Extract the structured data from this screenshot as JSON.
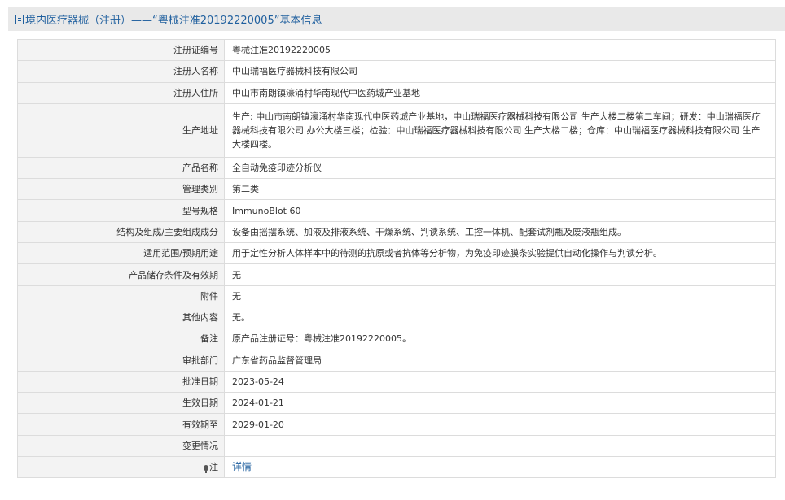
{
  "header": {
    "title": "境内医疗器械（注册）——“粤械注准20192220005”基本信息"
  },
  "rows": [
    {
      "label": "注册证编号",
      "value": "粤械注准20192220005"
    },
    {
      "label": "注册人名称",
      "value": "中山瑞福医疗器械科技有限公司"
    },
    {
      "label": "注册人住所",
      "value": "中山市南朗镇濠涌村华南现代中医药城产业基地"
    },
    {
      "label": "生产地址",
      "value": "生产: 中山市南朗镇濠涌村华南现代中医药城产业基地，中山瑞福医疗器械科技有限公司 生产大楼二楼第二车间；研发：中山瑞福医疗器械科技有限公司 办公大楼三楼；检验：中山瑞福医疗器械科技有限公司 生产大楼二楼；仓库：中山瑞福医疗器械科技有限公司 生产大楼四楼。"
    },
    {
      "label": "产品名称",
      "value": "全自动免疫印迹分析仪"
    },
    {
      "label": "管理类别",
      "value": "第二类"
    },
    {
      "label": "型号规格",
      "value": "ImmunoBlot 60"
    },
    {
      "label": "结构及组成/主要组成成分",
      "value": "设备由摇摆系统、加液及排液系统、干燥系统、判读系统、工控一体机、配套试剂瓶及废液瓶组成。"
    },
    {
      "label": "适用范围/预期用途",
      "value": "用于定性分析人体样本中的待测的抗原或者抗体等分析物，为免疫印迹膜条实验提供自动化操作与判读分析。"
    },
    {
      "label": "产品储存条件及有效期",
      "value": "无"
    },
    {
      "label": "附件",
      "value": "无"
    },
    {
      "label": "其他内容",
      "value": "无。"
    },
    {
      "label": "备注",
      "value": "原产品注册证号：粤械注准20192220005。"
    },
    {
      "label": "审批部门",
      "value": "广东省药品监督管理局"
    },
    {
      "label": "批准日期",
      "value": "2023-05-24"
    },
    {
      "label": "生效日期",
      "value": "2024-01-21"
    },
    {
      "label": "有效期至",
      "value": "2029-01-20"
    },
    {
      "label": "变更情况",
      "value": ""
    }
  ],
  "note": {
    "label": "注",
    "icon": "lightbulb-icon",
    "link_text": "详情"
  }
}
